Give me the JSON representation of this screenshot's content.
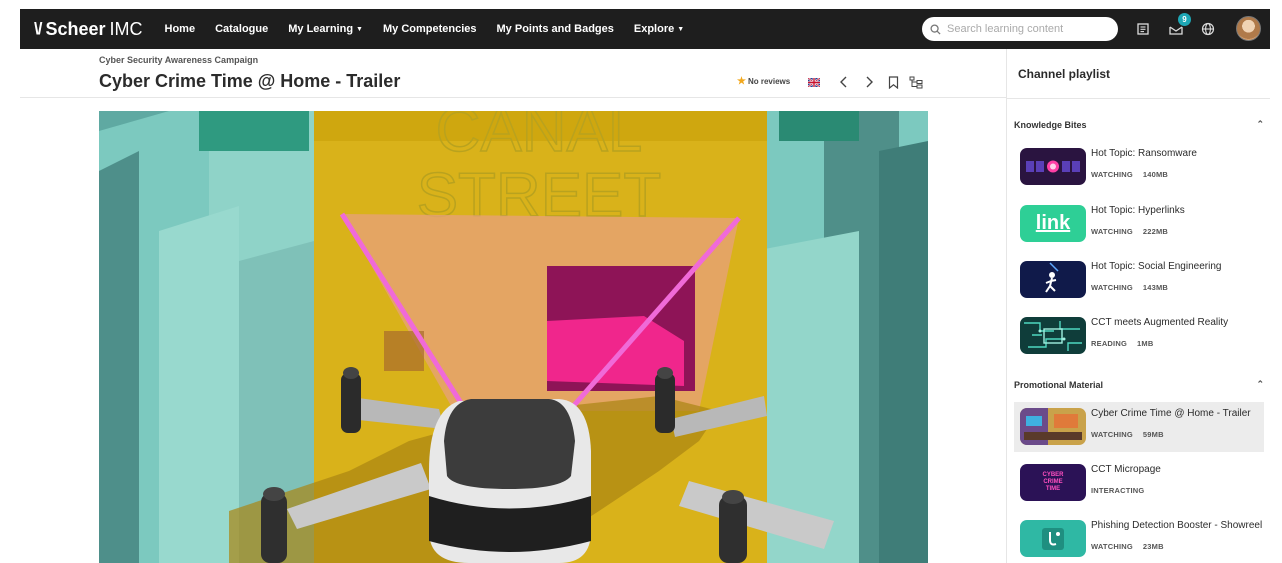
{
  "brand": {
    "mark": "\\/",
    "name_bold": "Scheer",
    "name_light": "IMC"
  },
  "nav": [
    {
      "label": "Home",
      "dropdown": false
    },
    {
      "label": "Catalogue",
      "dropdown": false
    },
    {
      "label": "My Learning",
      "dropdown": true
    },
    {
      "label": "My Competencies",
      "dropdown": false
    },
    {
      "label": "My Points and Badges",
      "dropdown": false
    },
    {
      "label": "Explore",
      "dropdown": true
    }
  ],
  "search": {
    "placeholder": "Search learning content"
  },
  "notifications": {
    "count": "9"
  },
  "header": {
    "overline": "Cyber Security Awareness Campaign",
    "title": "Cyber Crime Time @ Home - Trailer",
    "reviews": "No reviews"
  },
  "video": {
    "sign_line1": "CANAL",
    "sign_line2": "STREET"
  },
  "sidebar": {
    "title": "Channel playlist",
    "sections": [
      {
        "title": "Knowledge Bites",
        "items": [
          {
            "title": "Hot Topic: Ransomware",
            "status": "WATCHING",
            "size": "140MB",
            "thumb": "ransomware"
          },
          {
            "title": "Hot Topic: Hyperlinks",
            "status": "WATCHING",
            "size": "222MB",
            "thumb": "link",
            "thumb_text": "link"
          },
          {
            "title": "Hot Topic: Social Engineering",
            "status": "WATCHING",
            "size": "143MB",
            "thumb": "social"
          },
          {
            "title": "CCT meets Augmented Reality",
            "status": "READING",
            "size": "1MB",
            "thumb": "circuit"
          }
        ]
      },
      {
        "title": "Promotional Material",
        "items": [
          {
            "title": "Cyber Crime Time @ Home - Trailer",
            "status": "WATCHING",
            "size": "59MB",
            "thumb": "trailer",
            "active": true
          },
          {
            "title": "CCT Micropage",
            "status": "INTERACTING",
            "size": "",
            "thumb": "micropage",
            "thumb_text": "CYBER CRIME TIME"
          },
          {
            "title": "Phishing Detection Booster - Showreel",
            "status": "WATCHING",
            "size": "23MB",
            "thumb": "phishing"
          }
        ]
      }
    ]
  },
  "colors": {
    "topbar": "#1e1e1e",
    "accent": "#1ea7b5",
    "star": "#f2a81d",
    "active_row": "#ececec"
  }
}
